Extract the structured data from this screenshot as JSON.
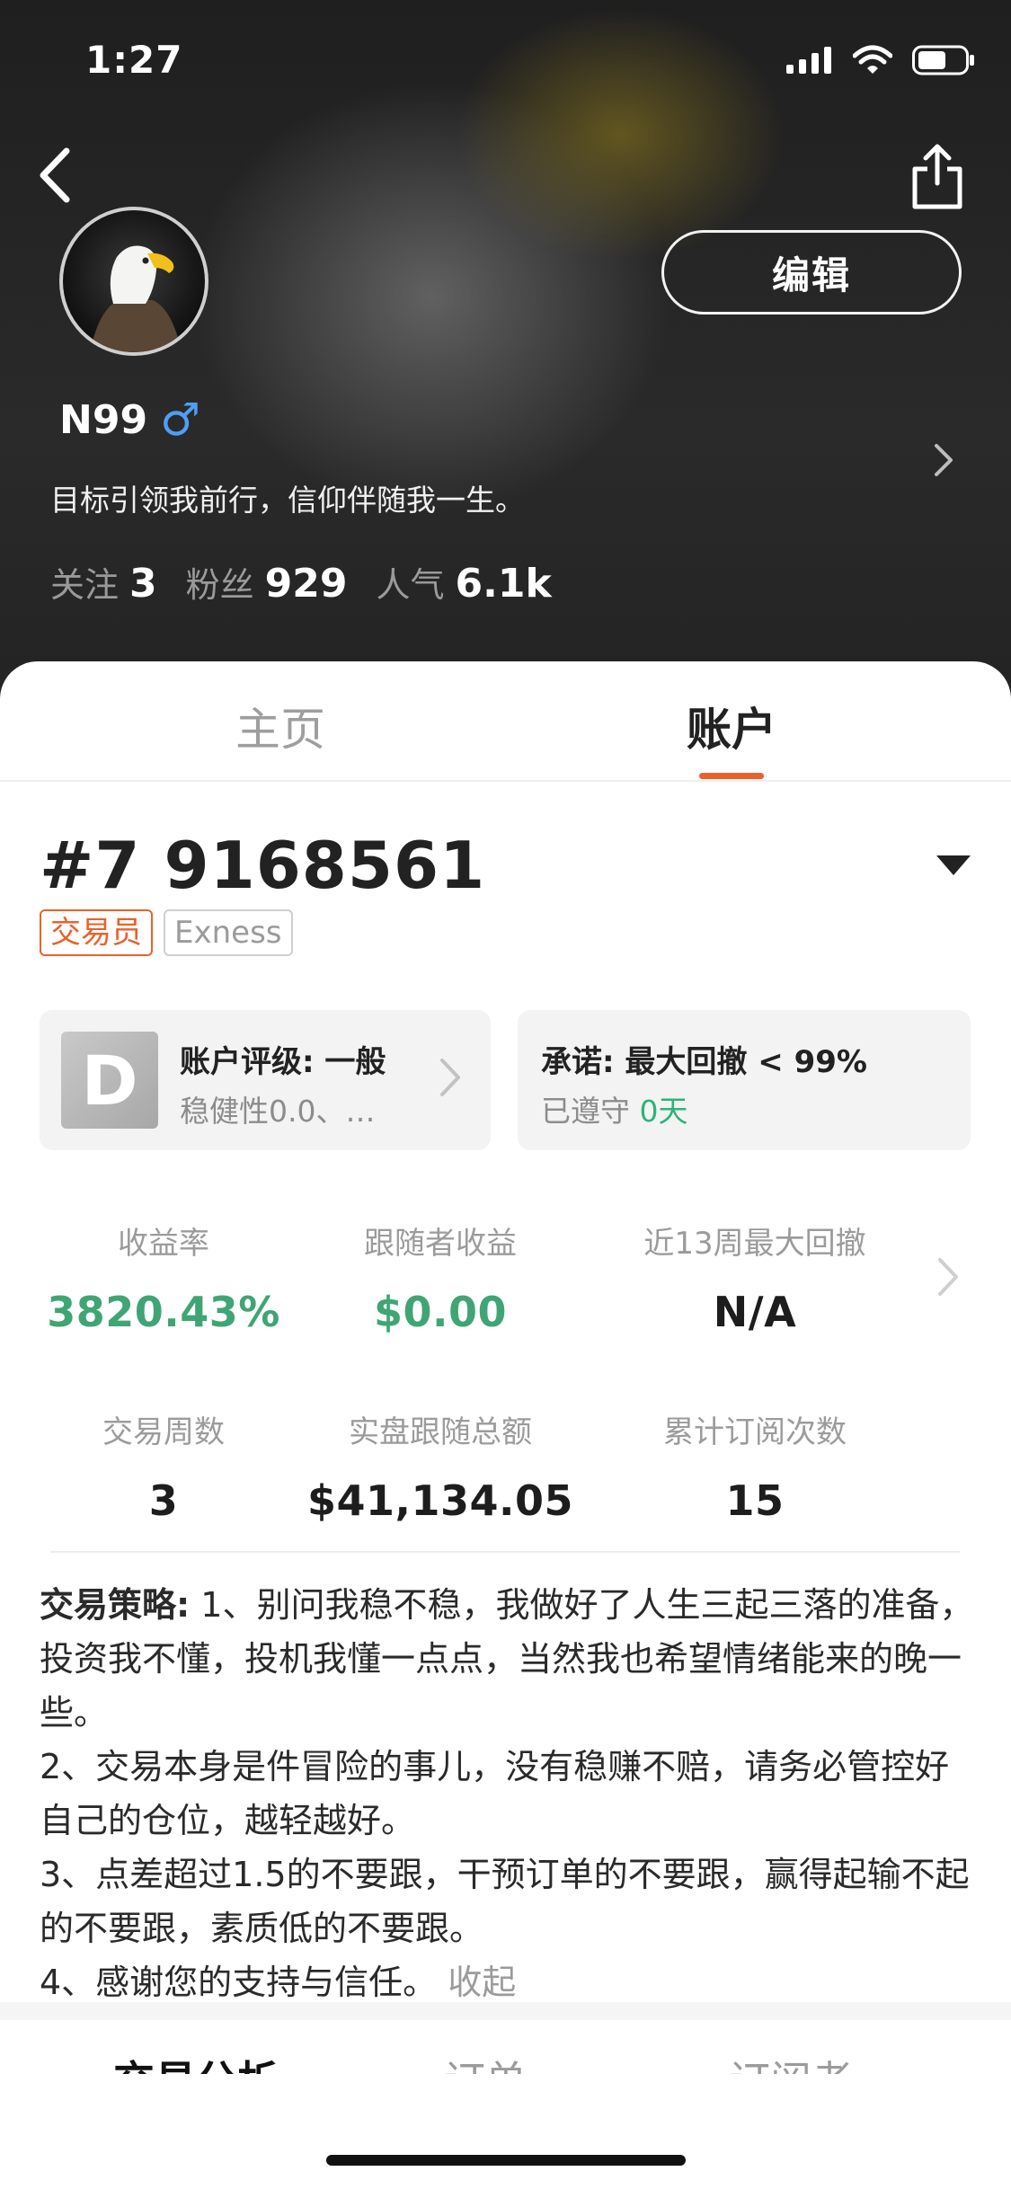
{
  "status_bar": {
    "time": "1:27"
  },
  "header": {
    "back_icon": "chevron-left-icon",
    "share_icon": "share-icon",
    "edit_label": "编辑"
  },
  "profile": {
    "avatar_icon": "eagle-avatar",
    "name": "N99",
    "gender_symbol": "♂",
    "bio": "目标引领我前行，信仰伴随我一生。",
    "stats": [
      {
        "label": "关注",
        "value": "3"
      },
      {
        "label": "粉丝",
        "value": "929"
      },
      {
        "label": "人气",
        "value": "6.1k"
      }
    ]
  },
  "tabs": [
    {
      "label": "主页",
      "active": false
    },
    {
      "label": "账户",
      "active": true
    }
  ],
  "account": {
    "number": "#7 9168561",
    "badges": [
      "交易员",
      "Exness"
    ],
    "rating_card": {
      "grade": "D",
      "title": "账户评级: 一般",
      "subtitle": "稳健性0.0、…"
    },
    "promise_card": {
      "title": "承诺: 最大回撤 < 99%",
      "status_label": "已遵守",
      "status_value": "0天"
    },
    "metrics": [
      {
        "label": "收益率",
        "value": "3820.43%"
      },
      {
        "label": "跟随者收益",
        "value": "$0.00"
      },
      {
        "label": "近13周最大回撤",
        "value": "N/A"
      },
      {
        "label": "交易周数",
        "value": "3"
      },
      {
        "label": "实盘跟随总额",
        "value": "$41,134.05"
      },
      {
        "label": "累计订阅次数",
        "value": "15"
      }
    ]
  },
  "strategy": {
    "lead": "交易策略:",
    "line1": " 1、别问我稳不稳，我做好了人生三起三落的准备，投资我不懂，投机我懂一点点，当然我也希望情绪能来的晚一些。",
    "line2": "2、交易本身是件冒险的事儿，没有稳赚不赔，请务必管控好自己的仓位，越轻越好。",
    "line3": "3、点差超过1.5的不要跟，干预订单的不要跟，赢得起输不起的不要跟，素质低的不要跟。",
    "line4": "4、感谢您的支持与信任。",
    "collapse_label": "收起"
  },
  "sub_tabs": [
    {
      "label": "交易分析",
      "active": true
    },
    {
      "label": "订单",
      "active": false
    },
    {
      "label": "订阅者",
      "active": false
    }
  ],
  "colors": {
    "accent": "#e8622c",
    "positive": "#3fa574",
    "compliance": "#2db37a",
    "gender": "#4f9ef5"
  }
}
